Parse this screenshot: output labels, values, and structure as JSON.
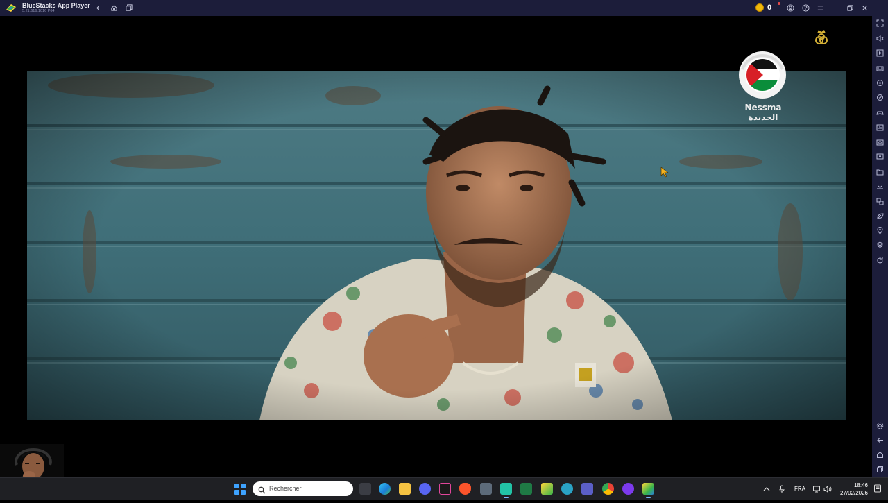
{
  "titlebar": {
    "app_name": "BlueStacks App Player",
    "version": "5.21.616.1016  P64",
    "coin_count": "0",
    "icons": [
      "back-icon",
      "home-icon",
      "multi-instance-icon",
      "account-icon",
      "help-icon",
      "menu-icon",
      "minimize-icon",
      "restore-icon",
      "close-icon"
    ]
  },
  "sidebar": {
    "icons": [
      "fullscreen-icon",
      "volume-icon",
      "media-manager-icon",
      "keyboard-controls-icon",
      "macro-icon",
      "sync-icon",
      "gamepad-icon",
      "performance-icon",
      "screenshot-icon",
      "record-icon",
      "media-folder-icon",
      "install-apk-icon",
      "multi-instance-manager-icon",
      "eco-mode-icon",
      "location-icon",
      "layers-icon",
      "rotate-icon",
      "settings-icon",
      "back-icon",
      "home-icon",
      "recent-apps-icon"
    ]
  },
  "video": {
    "channel_logo_text_latin": "Nessma",
    "channel_logo_text_arabic": "الجديدة",
    "colors": {
      "shutter": "#3f6e78",
      "frame_border": "#2a3a36"
    }
  },
  "taskbar": {
    "search_placeholder": "Rechercher",
    "apps": [
      "task-view",
      "edge",
      "file-explorer",
      "discord",
      "capcut",
      "brave",
      "calculator",
      "greenshot",
      "excel",
      "bluestacks-multi",
      "opera-gx",
      "teams",
      "chrome",
      "canva",
      "bluestacks"
    ],
    "language": "FRA",
    "time": "18:46",
    "date": "27/02/2026"
  }
}
